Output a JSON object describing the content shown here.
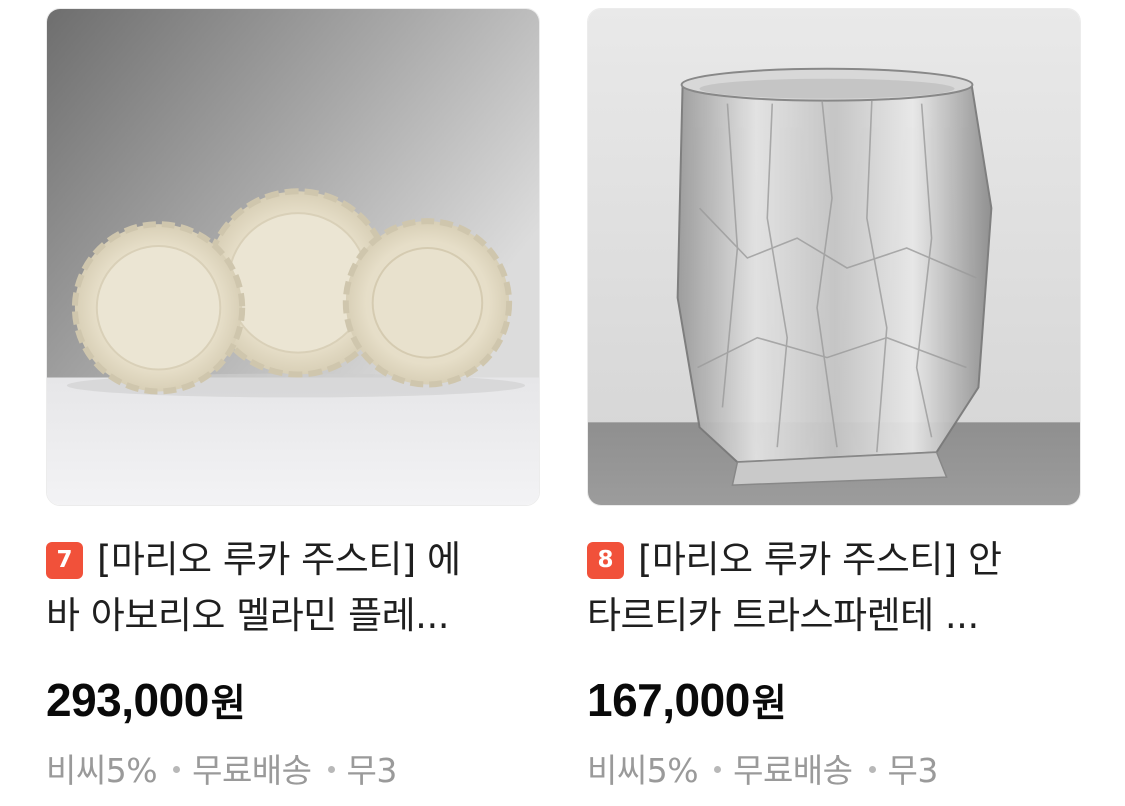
{
  "products": [
    {
      "rank": "7",
      "title_line1": "[마리오 루카 주스티] 에",
      "title_line2": "바 아보리오 멜라민 플레...",
      "price": "293,000",
      "currency": "원",
      "tags": [
        "비씨5%",
        "무료배송",
        "무3"
      ],
      "image_icon": "plates-product-image"
    },
    {
      "rank": "8",
      "title_line1": "[마리오 루카 주스티] 안",
      "title_line2": "타르티카 트라스파렌테 ...",
      "price": "167,000",
      "currency": "원",
      "tags": [
        "비씨5%",
        "무료배송",
        "무3"
      ],
      "image_icon": "ice-bucket-product-image"
    }
  ],
  "colors": {
    "rank_badge": "#f1513a",
    "meta_text": "#9a9a9a",
    "price_text": "#0a0a0a"
  }
}
